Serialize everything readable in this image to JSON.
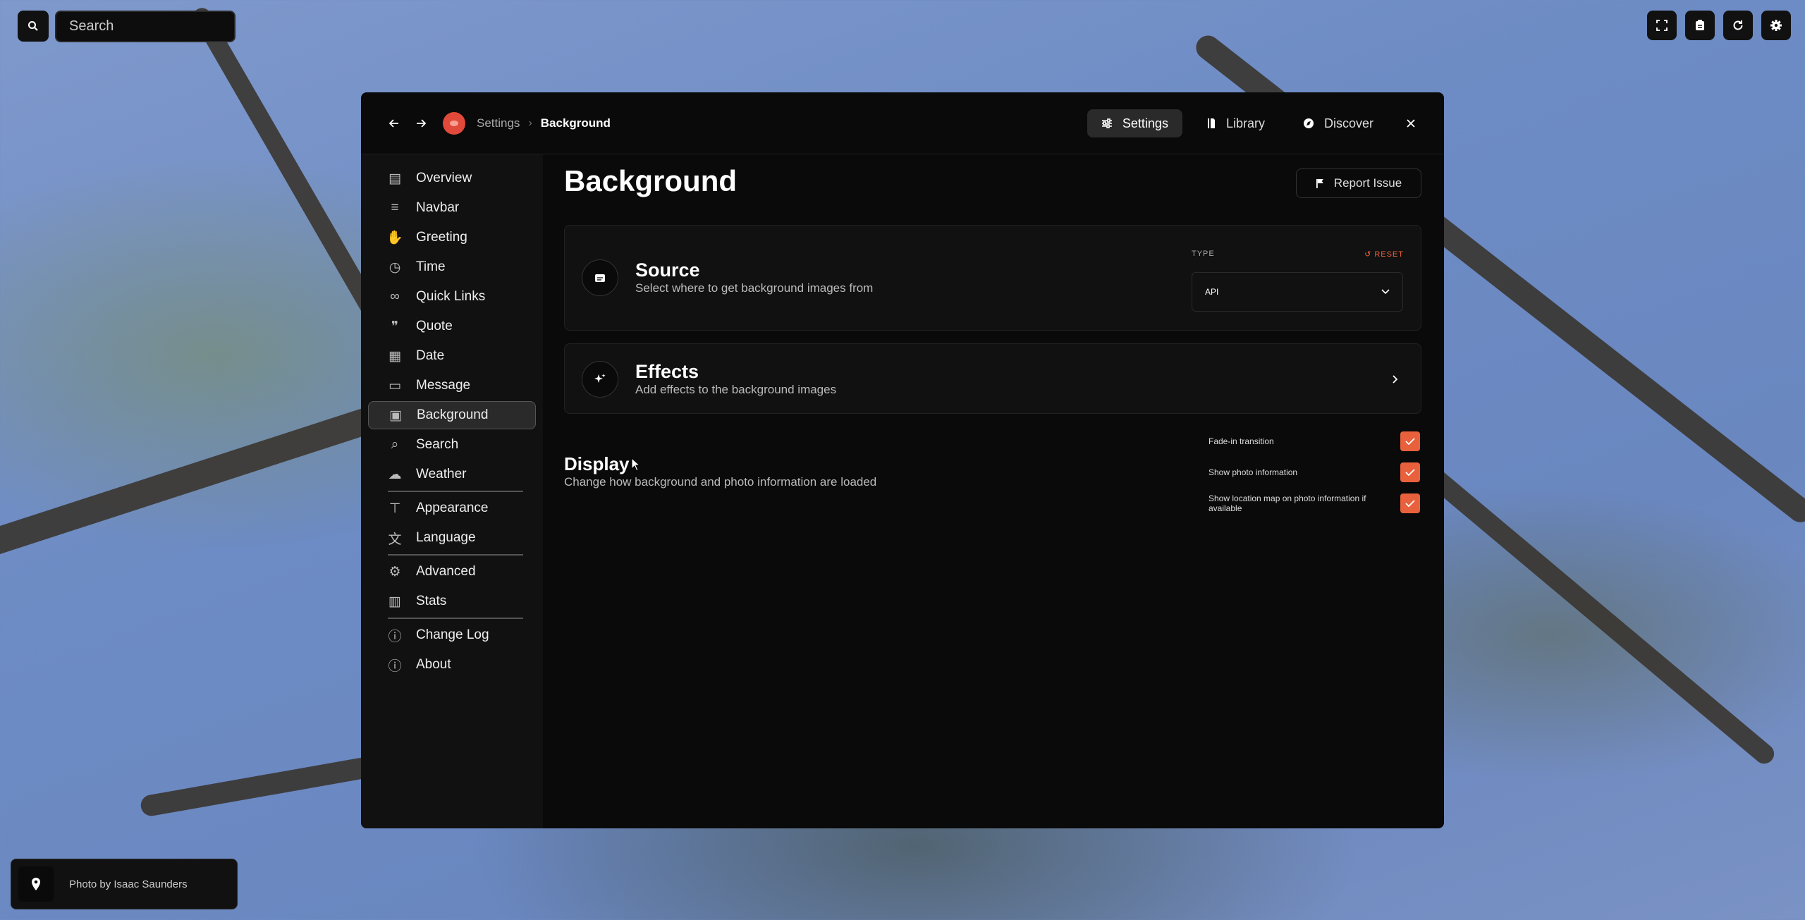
{
  "topbar": {
    "search_placeholder": "Search"
  },
  "header": {
    "breadcrumb_root": "Settings",
    "breadcrumb_current": "Background",
    "tabs": [
      {
        "label": "Settings",
        "icon": "sliders-icon",
        "active": true
      },
      {
        "label": "Library",
        "icon": "library-icon",
        "active": false
      },
      {
        "label": "Discover",
        "icon": "compass-icon",
        "active": false
      }
    ]
  },
  "sidebar": {
    "items": [
      {
        "label": "Overview",
        "icon": "overview-icon"
      },
      {
        "label": "Navbar",
        "icon": "navbar-icon"
      },
      {
        "label": "Greeting",
        "icon": "greeting-icon"
      },
      {
        "label": "Time",
        "icon": "alarm-icon"
      },
      {
        "label": "Quick Links",
        "icon": "link-icon"
      },
      {
        "label": "Quote",
        "icon": "quote-icon"
      },
      {
        "label": "Date",
        "icon": "calendar-icon"
      },
      {
        "label": "Message",
        "icon": "message-icon"
      },
      {
        "label": "Background",
        "icon": "image-icon",
        "active": true
      },
      {
        "label": "Search",
        "icon": "search-icon"
      },
      {
        "label": "Weather",
        "icon": "cloud-icon"
      },
      {
        "label": "Appearance",
        "icon": "paint-roller-icon"
      },
      {
        "label": "Language",
        "icon": "translate-icon"
      },
      {
        "label": "Advanced",
        "icon": "gear-icon"
      },
      {
        "label": "Stats",
        "icon": "stats-icon"
      },
      {
        "label": "Change Log",
        "icon": "info-icon"
      },
      {
        "label": "About",
        "icon": "info-icon"
      }
    ]
  },
  "main": {
    "title": "Background",
    "report_label": "Report Issue",
    "source": {
      "title": "Source",
      "subtitle": "Select where to get background images from",
      "type_label": "TYPE",
      "reset_label": "RESET",
      "type_value": "API"
    },
    "effects": {
      "title": "Effects",
      "subtitle": "Add effects to the background images"
    },
    "display": {
      "title": "Display",
      "subtitle": "Change how background and photo information are loaded",
      "options": [
        {
          "label": "Fade-in transition",
          "checked": true
        },
        {
          "label": "Show photo information",
          "checked": true
        },
        {
          "label": "Show location map on photo information if available",
          "checked": true
        }
      ]
    }
  },
  "photo_credit": "Photo by Isaac Saunders",
  "colors": {
    "accent": "#e8613c",
    "modal_bg": "#0a0a0a",
    "sidebar_bg": "#111111"
  }
}
